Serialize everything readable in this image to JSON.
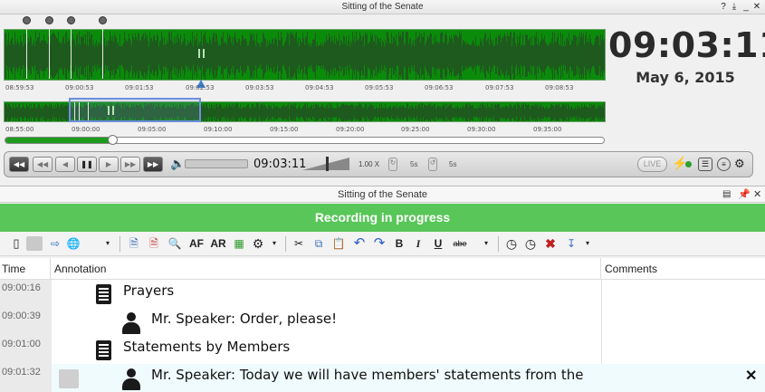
{
  "top_window": {
    "title": "Sitting of the Senate",
    "help_label": "?",
    "pin_label": "⤓",
    "close_label": "✕"
  },
  "timeline_detail": {
    "ticks": [
      "08:59:53",
      "09:00:53",
      "09:01:53",
      "09:02:53",
      "09:03:53",
      "09:04:53",
      "09:05:53",
      "09:06:53",
      "09:07:53",
      "09:08:53"
    ]
  },
  "timeline_overview": {
    "ticks": [
      "08:55:00",
      "09:00:00",
      "09:05:00",
      "09:10:00",
      "09:15:00",
      "09:20:00",
      "09:25:00",
      "09:30:00",
      "09:35:00"
    ]
  },
  "clock": {
    "time": "09:03:11",
    "date": "May 6, 2015"
  },
  "playback": {
    "position_fraction": 0.18,
    "time": "09:03:11",
    "speed": "1.00 X",
    "skip_back": "5s",
    "skip_fwd": "5s",
    "live_label": "LIVE",
    "volume_fraction": 0.72
  },
  "bottom_window": {
    "title": "Sitting of the Senate",
    "status": "Recording in progress"
  },
  "toolbar": {
    "af_label": "AF",
    "ar_label": "AR",
    "bold_label": "B",
    "italic_label": "I",
    "underline_label": "U",
    "strike_label": "abe"
  },
  "columns": {
    "time": "Time",
    "annotation": "Annotation",
    "comments": "Comments"
  },
  "rows": [
    {
      "time": "09:00:16",
      "type": "document",
      "text": "Prayers"
    },
    {
      "time": "09:00:39",
      "type": "speaker",
      "text": "Mr. Speaker: Order, please!"
    },
    {
      "time": "09:01:00",
      "type": "document",
      "text": "Statements by Members"
    },
    {
      "time": "09:01:32",
      "type": "speaker",
      "text": "Mr. Speaker: Today we will have members' statements from the"
    }
  ],
  "colors": {
    "waveform": "#0a8c0a",
    "recording_bar": "#58c658",
    "progress": "#1d9b1d"
  }
}
